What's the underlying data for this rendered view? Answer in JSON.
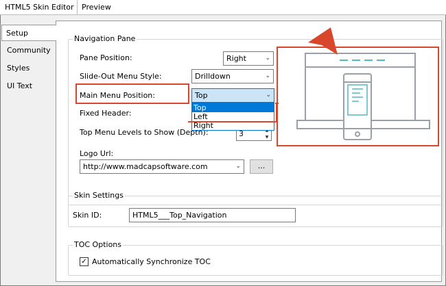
{
  "window": {
    "tabs": [
      "HTML5 Skin Editor",
      "Preview"
    ]
  },
  "side_tabs": [
    {
      "label": "Setup",
      "active": true
    },
    {
      "label": "Community",
      "active": false
    },
    {
      "label": "Styles",
      "active": false
    },
    {
      "label": "UI Text",
      "active": false
    }
  ],
  "navigation_pane": {
    "title": "Navigation Pane",
    "pane_position": {
      "label": "Pane Position:",
      "value": "Right"
    },
    "slide_out_style": {
      "label": "Slide-Out Menu Style:",
      "value": "Drilldown"
    },
    "main_menu_position": {
      "label": "Main Menu Position:",
      "value": "Top",
      "options": [
        "Top",
        "Left",
        "Right"
      ],
      "highlighted": "Top"
    },
    "fixed_header": {
      "label": "Fixed Header:"
    },
    "top_menu_levels": {
      "label": "Top Menu Levels to Show (Depth):",
      "value": "3"
    },
    "logo_url": {
      "label": "Logo Url:",
      "value": "http://www.madcapsoftware.com",
      "browse_label": "..."
    }
  },
  "skin_settings": {
    "title": "Skin Settings",
    "skin_id": {
      "label": "Skin ID:",
      "value": "HTML5___Top_Navigation"
    }
  },
  "toc_options": {
    "title": "TOC Options",
    "auto_sync": {
      "label": "Automatically Synchronize TOC",
      "checked": true
    }
  },
  "colors": {
    "callout": "#d8472b",
    "device_stroke": "#9aa0a6",
    "accent": "#4fb8c9",
    "selection": "#0078d7"
  },
  "icons": [
    "chevron-down-icon",
    "callout-arrow-icon",
    "layout-preview-illustration",
    "checkmark-icon"
  ]
}
